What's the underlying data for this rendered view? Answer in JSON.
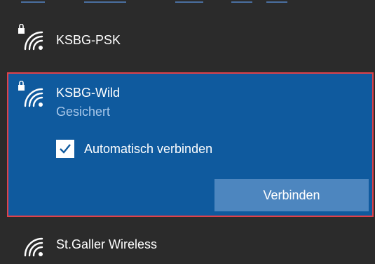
{
  "networks": [
    {
      "name": "KSBG-PSK",
      "secured": true,
      "icon": "wifi-lock-icon"
    },
    {
      "name": "KSBG-Wild",
      "secured": true,
      "icon": "wifi-lock-icon",
      "status": "Gesichert",
      "auto_connect_label": "Automatisch verbinden",
      "auto_connect_checked": true,
      "connect_label": "Verbinden"
    },
    {
      "name": "St.Galler Wireless",
      "secured": false,
      "icon": "wifi-icon"
    }
  ],
  "colors": {
    "background": "#2b2b2b",
    "selected_background": "#0f5a9e",
    "selection_border": "#e0414a",
    "button": "#4d86bf",
    "status_text": "#a9c8ea"
  }
}
